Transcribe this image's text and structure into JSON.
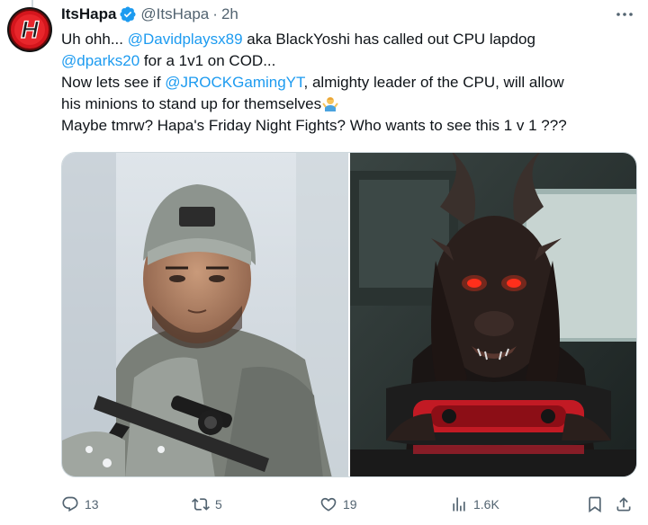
{
  "tweet": {
    "display_name": "ItsHapa",
    "handle": "@ItsHapa",
    "separator": "·",
    "time": "2h",
    "lines": [
      {
        "p1": "Uh ohh... ",
        "m1": "@Davidplaysx89",
        "p2": " aka BlackYoshi has called out CPU lapdog"
      },
      {
        "m1": "@dparks20",
        "p2": " for a 1v1 on COD..."
      },
      {
        "p1": "Now lets see if ",
        "m1": "@JROCKGamingYT",
        "p2": ", almighty leader of the CPU, will allow"
      },
      {
        "p1": "his minions to stand up for themselves"
      },
      {
        "p1": "Maybe tmrw? Hapa's Friday Night Fights? Who wants to see this 1 v 1 ???"
      }
    ],
    "emoji": "person-shrugging-emoji",
    "avatar_letter": "H"
  },
  "actions": {
    "replies": "13",
    "reposts": "5",
    "likes": "19",
    "views": "1.6K"
  },
  "icons": {
    "verified": "verified-badge-icon",
    "more": "more-horizontal-icon",
    "reply": "reply-icon",
    "repost": "repost-icon",
    "like": "heart-icon",
    "views": "views-chart-icon",
    "bookmark": "bookmark-icon",
    "share": "share-icon"
  },
  "colors": {
    "accent": "#1d9bf0",
    "secondary_text": "#536471",
    "avatar_red": "#e0181f"
  }
}
